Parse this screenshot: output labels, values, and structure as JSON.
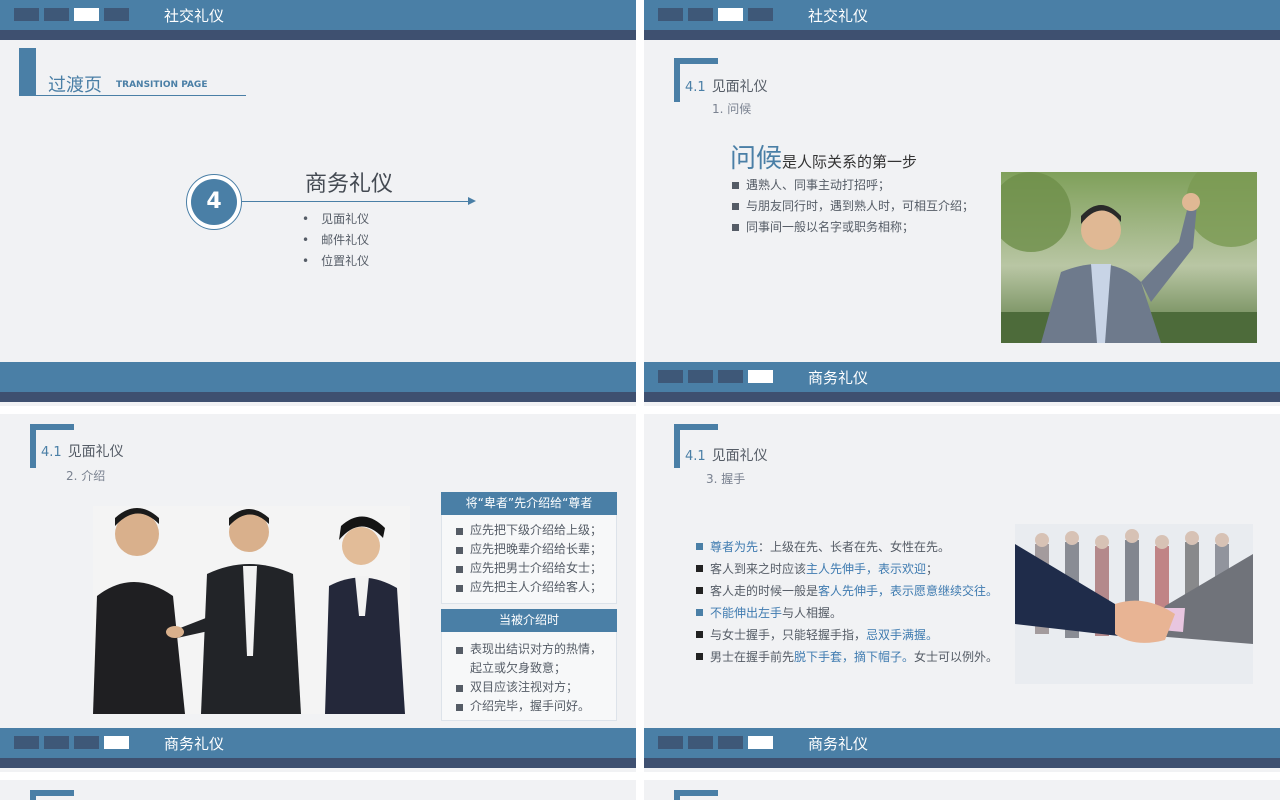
{
  "slides": {
    "s1": {
      "band_title": "社交礼仪",
      "heading": "过渡页",
      "heading_en": "TRANSITION PAGE",
      "badge_number": "4",
      "topic": "商务礼仪",
      "items": [
        "见面礼仪",
        "邮件礼仪",
        "位置礼仪"
      ]
    },
    "s2": {
      "band_title": "社交礼仪",
      "section_num": "4.1",
      "section_title": "见面礼仪",
      "sub_title": "1. 问候",
      "headline_big": "问候",
      "headline_rest": "是人际关系的第一步",
      "bullets": [
        "遇熟人、同事主动打招呼；",
        "与朋友同行时，遇到熟人时，可相互介绍；",
        "同事间一般以名字或职务相称；"
      ],
      "footer_title": "商务礼仪"
    },
    "s3": {
      "section_num": "4.1",
      "section_title": "见面礼仪",
      "sub_title": "2. 介绍",
      "box1_title": "将“卑者”先介绍给“尊者",
      "box1_items": [
        "应先把下级介绍给上级；",
        "应先把晚辈介绍给长辈；",
        "应先把男士介绍给女士；",
        "应先把主人介绍给客人；"
      ],
      "box2_title": "当被介绍时",
      "box2_items": [
        "表现出结识对方的热情，",
        "起立或欠身致意；",
        "双目应该注视对方；",
        "介绍完毕，握手问好。"
      ],
      "footer_title": "商务礼仪"
    },
    "s4": {
      "section_num": "4.1",
      "section_title": "见面礼仪",
      "sub_title": "3. 握手",
      "lines": [
        {
          "a": "尊者为先",
          "b": "：上级在先、长者在先、女性在先。",
          "c": "",
          "d": ""
        },
        {
          "a": "",
          "b": "客人到来之时应该",
          "c": "主人先伸手，表示欢迎",
          "d": "；"
        },
        {
          "a": "",
          "b": "客人走的时候一般是",
          "c": "客人先伸手，表示愿意继续交往。",
          "d": ""
        },
        {
          "a": "不能伸出左手",
          "b": "与人相握。",
          "c": "",
          "d": ""
        },
        {
          "a": "",
          "b": "与女士握手，只能轻握手指，",
          "c": "忌双手满握。",
          "d": ""
        },
        {
          "a": "",
          "b": "男士在握手前先",
          "c": "脱下手套，摘下帽子。",
          "d": "女士可以例外。"
        }
      ],
      "footer_title": "商务礼仪"
    }
  },
  "colors": {
    "band": "#4a7fa6",
    "band_dark": "#3e5070",
    "accent": "#3f7bb0",
    "slide_bg": "#f1f2f4"
  }
}
